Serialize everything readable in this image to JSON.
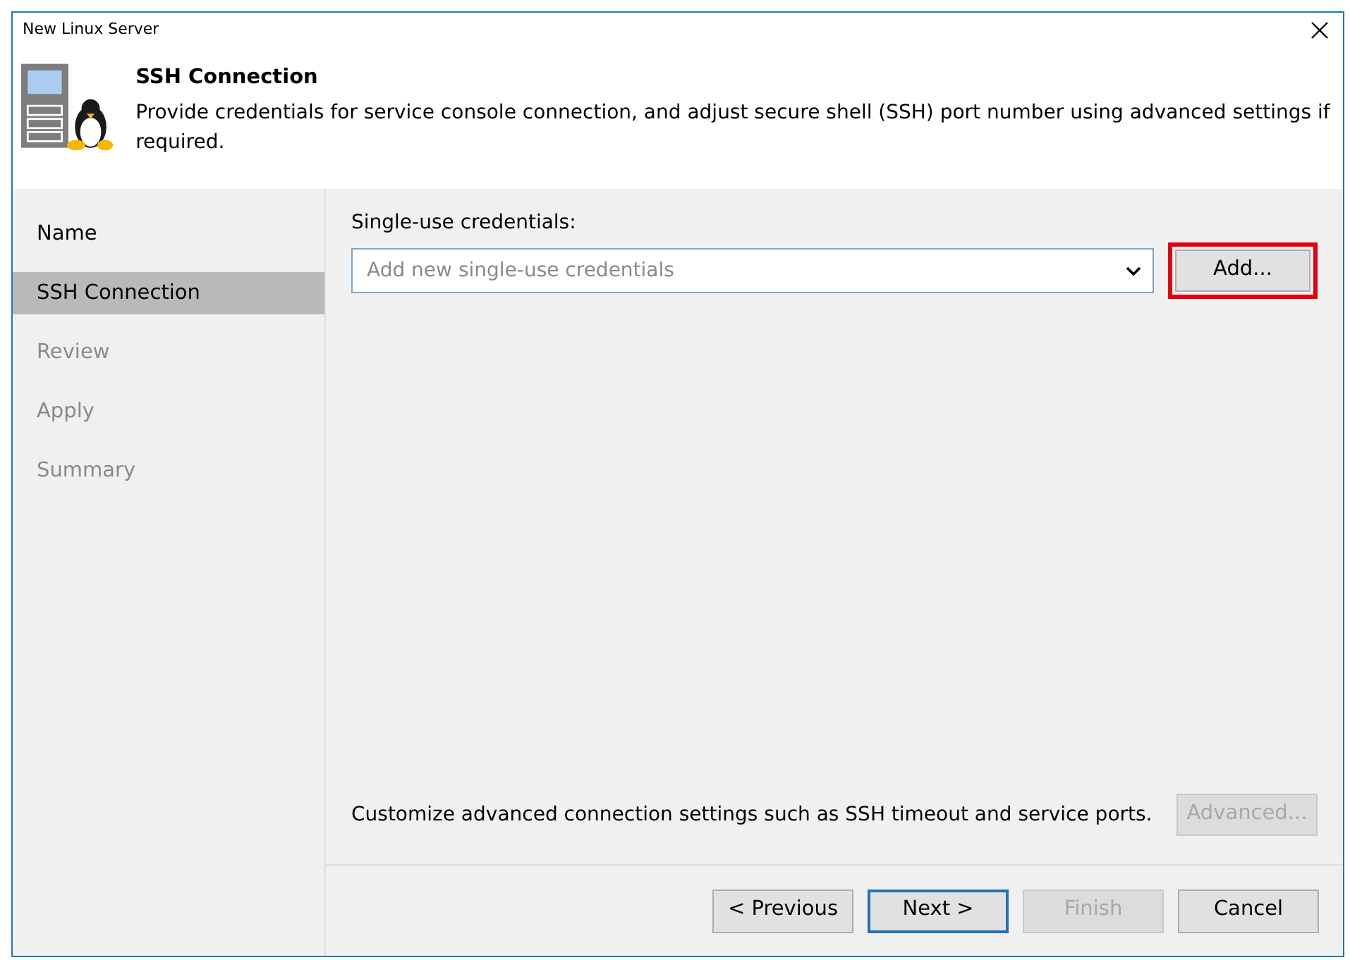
{
  "window": {
    "title": "New Linux Server"
  },
  "header": {
    "title": "SSH Connection",
    "description": "Provide credentials for service console connection, and adjust secure shell (SSH) port number using advanced settings if required."
  },
  "steps": [
    {
      "label": "Name",
      "selected": false,
      "disabled": false
    },
    {
      "label": "SSH Connection",
      "selected": true,
      "disabled": false
    },
    {
      "label": "Review",
      "selected": false,
      "disabled": true
    },
    {
      "label": "Apply",
      "selected": false,
      "disabled": true
    },
    {
      "label": "Summary",
      "selected": false,
      "disabled": true
    }
  ],
  "credentials": {
    "label": "Single-use credentials:",
    "placeholder": "Add new single-use credentials",
    "add_button": {
      "label": "Add...",
      "highlighted": true
    }
  },
  "advanced": {
    "text": "Customize advanced connection settings such as SSH timeout and service ports.",
    "button": {
      "label": "Advanced...",
      "disabled": true
    }
  },
  "buttons": [
    {
      "label": "< Previous",
      "disabled": false,
      "default": false
    },
    {
      "label": "Next >",
      "disabled": false,
      "default": true
    },
    {
      "label": "Finish",
      "disabled": true,
      "default": false
    },
    {
      "label": "Cancel",
      "disabled": false,
      "default": false
    }
  ]
}
